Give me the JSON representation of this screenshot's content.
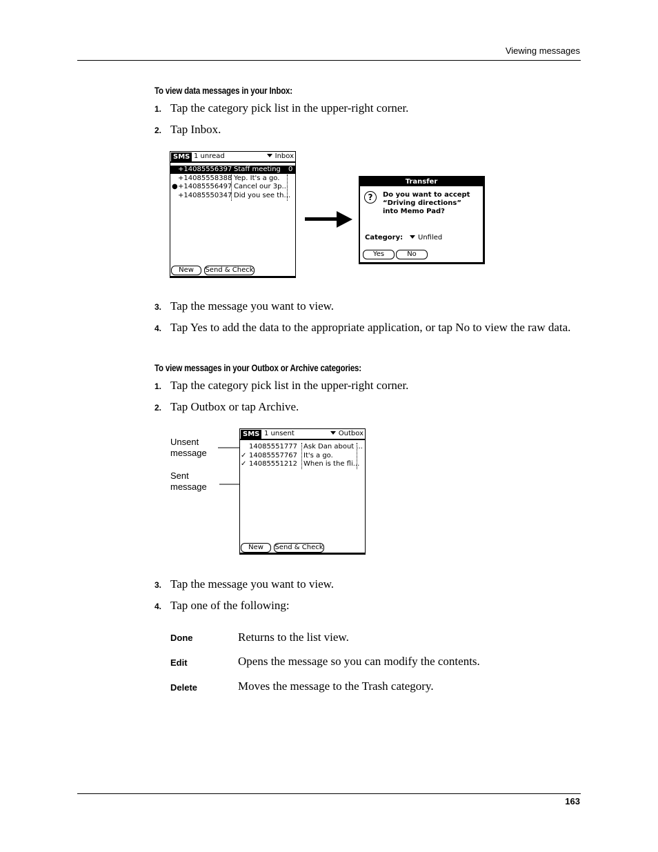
{
  "header": {
    "section": "Viewing messages"
  },
  "footer": {
    "page_number": "163"
  },
  "section1": {
    "heading": "To view data messages in your Inbox:",
    "steps": [
      {
        "num": "1.",
        "text": "Tap the category pick list in the upper-right corner."
      },
      {
        "num": "2.",
        "text": "Tap Inbox."
      },
      {
        "num": "3.",
        "text": "Tap the message you want to view."
      },
      {
        "num": "4.",
        "text": "Tap Yes to add the data to the appropriate application, or tap No to view the raw data."
      }
    ]
  },
  "inbox_screen": {
    "app": "SMS",
    "status": "1 unread",
    "category": "Inbox",
    "rows": [
      {
        "number": "+14085556397",
        "subject": "Staff meeting",
        "selected": true,
        "bullet": false,
        "attach": "0"
      },
      {
        "number": "+14085558388",
        "subject": "Yep. It's a go.",
        "selected": false,
        "bullet": false
      },
      {
        "number": "+14085556497",
        "subject": "Cancel our 3p...",
        "selected": false,
        "bullet": true
      },
      {
        "number": "+14085550347",
        "subject": "Did you see th...",
        "selected": false,
        "bullet": false
      }
    ],
    "buttons": {
      "new": "New",
      "send_check": "Send & Check"
    }
  },
  "transfer_dialog": {
    "title": "Transfer",
    "line1": "Do you want to accept",
    "line2": "“Driving directions”",
    "line3": "into Memo Pad?",
    "category_label": "Category:",
    "category_value": "Unfiled",
    "yes": "Yes",
    "no": "No"
  },
  "section2": {
    "heading": "To view messages in your Outbox or Archive categories:",
    "steps": [
      {
        "num": "1.",
        "text": "Tap the category pick list in the upper-right corner."
      },
      {
        "num": "2.",
        "text": "Tap Outbox or tap Archive."
      },
      {
        "num": "3.",
        "text": "Tap the message you want to view."
      },
      {
        "num": "4.",
        "text": "Tap one of the following:"
      }
    ]
  },
  "outbox_screen": {
    "app": "SMS",
    "status": "1 unsent",
    "category": "Outbox",
    "rows": [
      {
        "number": "14085551777",
        "subject": "Ask Dan about ...",
        "check": ""
      },
      {
        "number": "14085557767",
        "subject": "It's a go.",
        "check": "✓"
      },
      {
        "number": "14085551212",
        "subject": "When is the fli...",
        "check": "✓"
      }
    ],
    "buttons": {
      "new": "New",
      "send_check": "Send & Check"
    }
  },
  "callouts": {
    "unsent": "Unsent\nmessage",
    "sent": "Sent\nmessage"
  },
  "options": [
    {
      "term": "Done",
      "desc": "Returns to the list view."
    },
    {
      "term": "Edit",
      "desc": "Opens the message so you can modify the contents."
    },
    {
      "term": "Delete",
      "desc": "Moves the message to the Trash category."
    }
  ]
}
